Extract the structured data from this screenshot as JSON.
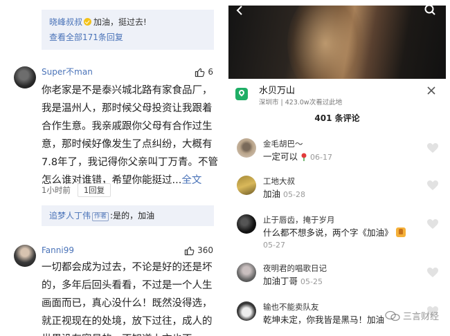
{
  "left": {
    "top_reply": {
      "name": "晓峰叔叔",
      "text": "加油，挺过去!",
      "view_all": "查看全部171条回复"
    },
    "comments": [
      {
        "username": "Super不man",
        "likes": "6",
        "lines": [
          "你老家是不是泰兴城北路有家食品厂，",
          "我是温州人，那时候父母投资让我跟着",
          "合作生意。我亲戚跟你父母有合作过生",
          "意，那时候好像发生了点纠纷，大概有",
          "7.8年了，我记得你父亲叫丁万青。不管",
          "怎么谁对谁错，希望你能挺过..."
        ],
        "full_text_link": "全文",
        "time": "1小时前",
        "reply_label": "1回复",
        "sub_reply": {
          "name": "追梦人丁伟",
          "tag": "作者",
          "text": ":是的，加油"
        }
      },
      {
        "username": "Fanni99",
        "likes": "360",
        "lines": [
          "一切都会成为过去，不论是好的还是坏",
          "的，多年后回头看看，不过是一个人生",
          "画面而已，真心没什么！既然没得选，",
          "就正视现在的处境，放下过往，成人的",
          "世界没有容易的，不知道上文也不..."
        ]
      }
    ]
  },
  "right": {
    "location": {
      "title": "水贝万山",
      "subtitle": "深圳市 | 423.0w次看过此地"
    },
    "comment_count": "401 条评论",
    "comments": [
      {
        "name": "金毛胡巴～",
        "text": "一定可以",
        "date": "06-17",
        "emoji": "rose"
      },
      {
        "name": "工地大叔",
        "text": "加油",
        "date": "05-28"
      },
      {
        "name": "止于唇齿，掩于岁月",
        "text": "什么都不想多说，两个字《加油》",
        "date": "05-27",
        "emoji": "thumb"
      },
      {
        "name": "夜明君的唱歌日记",
        "text": "加油丁哥",
        "date": "05-25"
      },
      {
        "name": "输也不能卖队友",
        "text": "乾坤未定，你我皆是黑马！加油"
      }
    ]
  },
  "watermark": {
    "text": "三言财经"
  },
  "colors": {
    "link_blue": "#4a73b8",
    "reply_bg": "#eef1f8",
    "location_green": "#1fae66"
  }
}
